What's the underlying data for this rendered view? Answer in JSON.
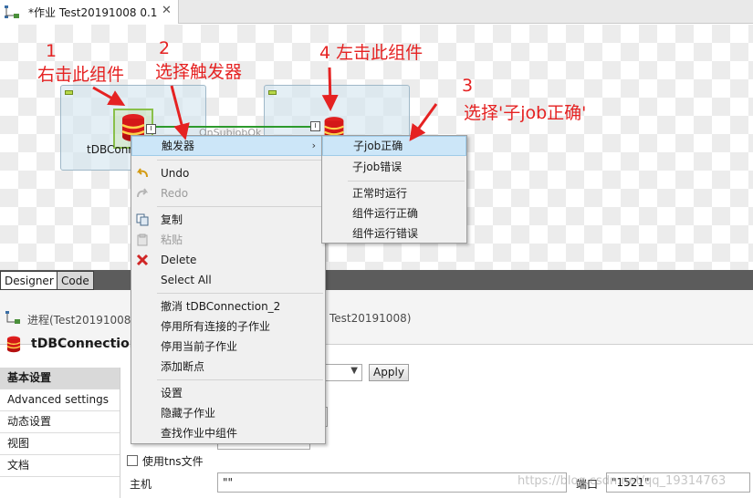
{
  "editor_tab": {
    "title": "*作业 Test20191008 0.1",
    "close": "✕"
  },
  "canvas": {
    "component1_label": "tDBConnection",
    "connection_label": "OnSubjobOk",
    "port_label": "I"
  },
  "annotations": {
    "step1_number": "1",
    "step1_text": "右击此组件",
    "step2_number": "2",
    "step2_text": "选择触发器",
    "step3_number": "3",
    "step3_text": "选择'子job正确'",
    "step4_text": "4  左击此组件",
    "color": "#e52222"
  },
  "bottom_tabs": {
    "designer": "Designer",
    "code": "Code"
  },
  "panel": {
    "process_prefix": "进程(Test20191008",
    "process_suffix": "Test20191008)",
    "component_title": "tDBConnection"
  },
  "settings_nav": [
    "基本设置",
    "Advanced settings",
    "动态设置",
    "视图",
    "文档"
  ],
  "form": {
    "apply_label": "Apply",
    "tns_label": "使用tns文件",
    "host_label": "主机",
    "host_value": "\"\"",
    "port_label": "端口",
    "port_value": "\"1521\""
  },
  "watermark": "https://blog.csdn.net/qq_19314763",
  "context_menu": {
    "trigger": "触发器",
    "undo": "Undo",
    "redo": "Redo",
    "copy": "复制",
    "paste": "粘贴",
    "delete": "Delete",
    "select_all": "Select All",
    "deactivate": "撤消 tDBConnection_2",
    "disable_subjobs": "停用所有连接的子作业",
    "disable_current": "停用当前子作业",
    "add_breakpoint": "添加断点",
    "settings": "设置",
    "hide_subjob": "隐藏子作业",
    "find_component": "查找作业中组件"
  },
  "submenu": {
    "subjob_ok": "子job正确",
    "subjob_error": "子job错误",
    "run_if": "正常时运行",
    "component_ok": "组件运行正确",
    "component_error": "组件运行错误"
  },
  "colors": {
    "menu_highlight": "#cce6f8",
    "connection": "#2d9a2d"
  }
}
